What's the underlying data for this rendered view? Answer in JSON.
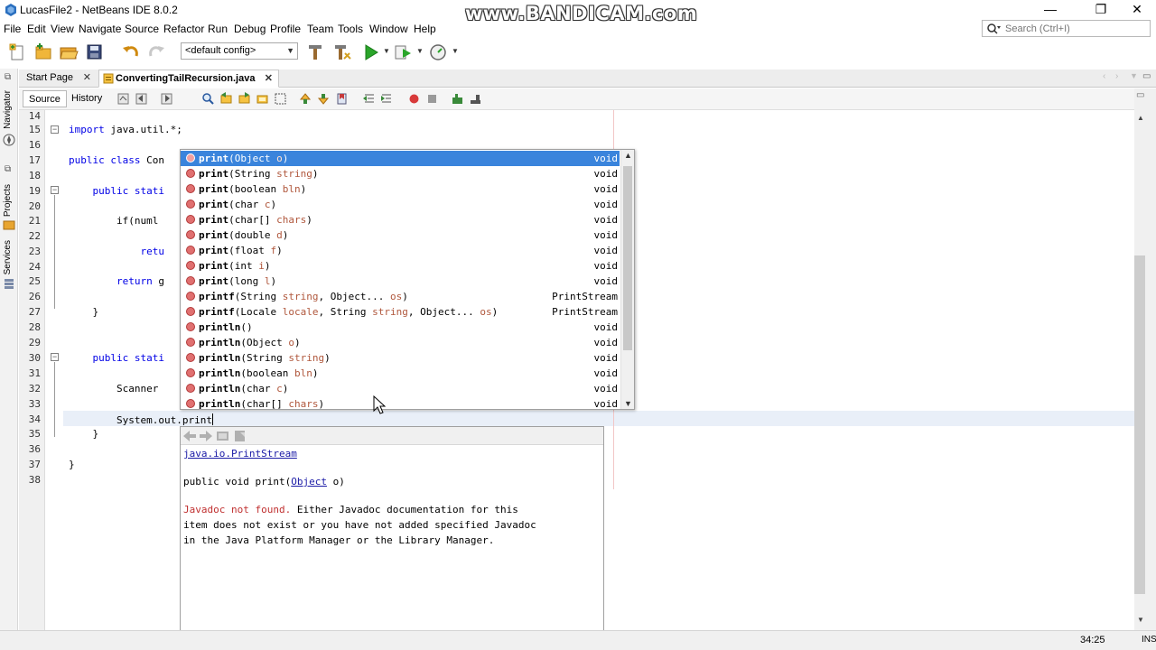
{
  "window": {
    "title": "LucasFile2 - NetBeans IDE 8.0.2"
  },
  "watermark": "www.BANDICAM.com",
  "window_controls": {
    "minimize": "—",
    "maximize": "❐",
    "close": "✕"
  },
  "menu": [
    "File",
    "Edit",
    "View",
    "Navigate",
    "Source",
    "Refactor",
    "Run",
    "Debug",
    "Profile",
    "Team",
    "Tools",
    "Window",
    "Help"
  ],
  "search": {
    "placeholder": "Search (Ctrl+I)"
  },
  "toolbar": {
    "config": "<default config>"
  },
  "side_panels": [
    "Navigator",
    "Projects",
    "Services"
  ],
  "tabs": [
    {
      "label": "Start Page",
      "close": "✕",
      "active": false
    },
    {
      "label": "ConvertingTailRecursion.java",
      "close": "✕",
      "active": true
    }
  ],
  "editor_toolbar": {
    "source": "Source",
    "history": "History"
  },
  "editor": {
    "line_numbers": [
      "14",
      "15",
      "16",
      "17",
      "18",
      "19",
      "20",
      "21",
      "22",
      "23",
      "24",
      "25",
      "26",
      "27",
      "28",
      "29",
      "30",
      "31",
      "32",
      "33",
      "34",
      "35",
      "36",
      "37",
      "38"
    ],
    "lines": [
      {
        "kw": "",
        "text": ""
      },
      {
        "kw": "import",
        "text": " java.util.*;"
      },
      {
        "kw": "",
        "text": ""
      },
      {
        "kw": "public class",
        "text": " Con"
      },
      {
        "kw": "",
        "text": ""
      },
      {
        "kw": "    public stati",
        "text": ""
      },
      {
        "kw": "",
        "text": ""
      },
      {
        "kw": "",
        "text": "        if(numl"
      },
      {
        "kw": "",
        "text": ""
      },
      {
        "kw": "            retu",
        "text": ""
      },
      {
        "kw": "",
        "text": ""
      },
      {
        "kw": "        return",
        "text": " g"
      },
      {
        "kw": "",
        "text": ""
      },
      {
        "kw": "",
        "text": "    }"
      },
      {
        "kw": "",
        "text": ""
      },
      {
        "kw": "",
        "text": ""
      },
      {
        "kw": "    public stati",
        "text": ""
      },
      {
        "kw": "",
        "text": ""
      },
      {
        "kw": "",
        "text": "        Scanner"
      },
      {
        "kw": "",
        "text": ""
      },
      {
        "kw": "",
        "text": "        System.out.print"
      },
      {
        "kw": "",
        "text": "    }"
      },
      {
        "kw": "",
        "text": ""
      },
      {
        "kw": "",
        "text": "}"
      },
      {
        "kw": "",
        "text": ""
      }
    ]
  },
  "completion": {
    "items": [
      {
        "name": "print",
        "open": "(",
        "params": [
          [
            "Object",
            "o"
          ]
        ],
        "tail": ")",
        "ret": "void"
      },
      {
        "name": "print",
        "open": "(",
        "params": [
          [
            "String",
            "string"
          ]
        ],
        "tail": ")",
        "ret": "void"
      },
      {
        "name": "print",
        "open": "(",
        "params": [
          [
            "boolean",
            "bln"
          ]
        ],
        "tail": ")",
        "ret": "void"
      },
      {
        "name": "print",
        "open": "(",
        "params": [
          [
            "char",
            "c"
          ]
        ],
        "tail": ")",
        "ret": "void"
      },
      {
        "name": "print",
        "open": "(",
        "params": [
          [
            "char[]",
            "chars"
          ]
        ],
        "tail": ")",
        "ret": "void"
      },
      {
        "name": "print",
        "open": "(",
        "params": [
          [
            "double",
            "d"
          ]
        ],
        "tail": ")",
        "ret": "void"
      },
      {
        "name": "print",
        "open": "(",
        "params": [
          [
            "float",
            "f"
          ]
        ],
        "tail": ")",
        "ret": "void"
      },
      {
        "name": "print",
        "open": "(",
        "params": [
          [
            "int",
            "i"
          ]
        ],
        "tail": ")",
        "ret": "void"
      },
      {
        "name": "print",
        "open": "(",
        "params": [
          [
            "long",
            "l"
          ]
        ],
        "tail": ")",
        "ret": "void"
      },
      {
        "name": "printf",
        "open": "(",
        "params": [
          [
            "String",
            "string"
          ],
          [
            "Object...",
            "os"
          ]
        ],
        "tail": ")",
        "ret": "PrintStream"
      },
      {
        "name": "printf",
        "open": "(",
        "params": [
          [
            "Locale",
            "locale"
          ],
          [
            "String",
            "string"
          ],
          [
            "Object...",
            "os"
          ]
        ],
        "tail": ")",
        "ret": "PrintStream"
      },
      {
        "name": "println",
        "open": "(",
        "params": [],
        "tail": ")",
        "ret": "void"
      },
      {
        "name": "println",
        "open": "(",
        "params": [
          [
            "Object",
            "o"
          ]
        ],
        "tail": ")",
        "ret": "void"
      },
      {
        "name": "println",
        "open": "(",
        "params": [
          [
            "String",
            "string"
          ]
        ],
        "tail": ")",
        "ret": "void"
      },
      {
        "name": "println",
        "open": "(",
        "params": [
          [
            "boolean",
            "bln"
          ]
        ],
        "tail": ")",
        "ret": "void"
      },
      {
        "name": "println",
        "open": "(",
        "params": [
          [
            "char",
            "c"
          ]
        ],
        "tail": ")",
        "ret": "void"
      },
      {
        "name": "println",
        "open": "(",
        "params": [
          [
            "char[]",
            "chars"
          ]
        ],
        "tail": ")",
        "ret": "void"
      }
    ]
  },
  "javadoc": {
    "class_link": "java.io.PrintStream",
    "signature_prefix": "public void print(",
    "signature_type": "Object",
    "signature_suffix": " o)",
    "not_found": "Javadoc not found.",
    "message_1": " Either Javadoc documentation for this",
    "message_2": "item does not exist or you have not added specified Javadoc",
    "message_3": "in the Java Platform Manager or the Library Manager."
  },
  "status": {
    "position": "34:25",
    "mode": "INS"
  }
}
